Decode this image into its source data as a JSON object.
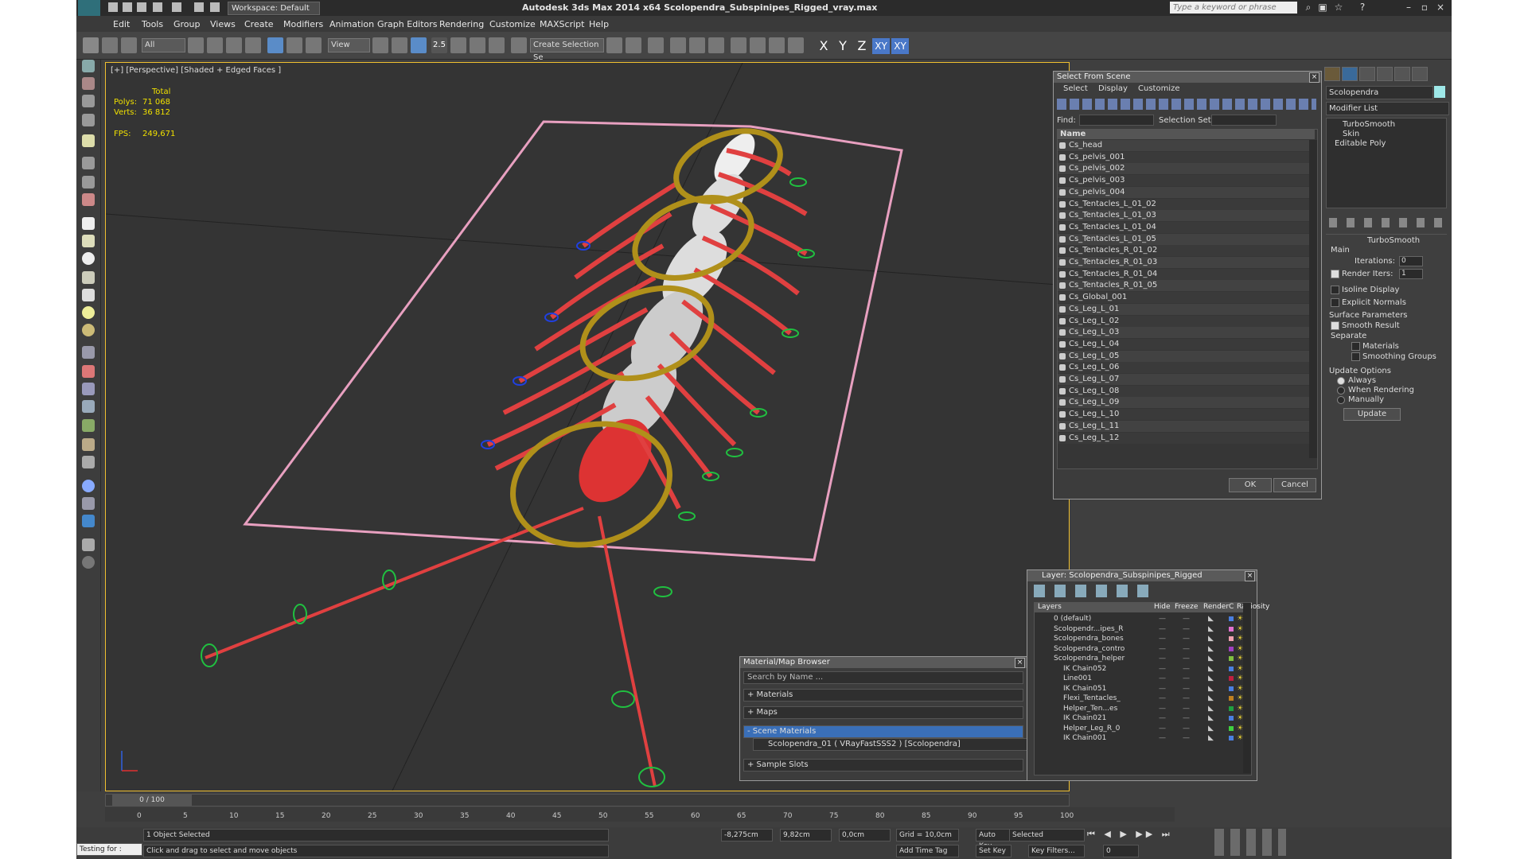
{
  "app": {
    "title": "Autodesk 3ds Max  2014 x64      Scolopendra_Subspinipes_Rigged_vray.max",
    "workspace": "Workspace: Default",
    "search_placeholder": "Type a keyword or phrase"
  },
  "menu": [
    "Edit",
    "Tools",
    "Group",
    "Views",
    "Create",
    "Modifiers",
    "Animation",
    "Graph Editors",
    "Rendering",
    "Customize",
    "MAXScript",
    "Help"
  ],
  "toolbar": {
    "filter": "All",
    "view": "View",
    "snap_angle": "2.5",
    "selection_set": "Create Selection Se",
    "axes": [
      "X",
      "Y",
      "Z",
      "XY",
      "XY"
    ]
  },
  "viewport": {
    "label": "[+] [Perspective] [Shaded + Edged Faces ]",
    "stats_total": "Total",
    "polys_label": "Polys:",
    "polys": "71 068",
    "verts_label": "Verts:",
    "verts": "36 812",
    "fps_label": "FPS:",
    "fps": "249,671"
  },
  "command_panel": {
    "object_name": "Scolopendra",
    "modifier_list": "Modifier List",
    "stack": [
      "TurboSmooth",
      "Skin",
      "Editable Poly"
    ],
    "rollout_title": "TurboSmooth",
    "main_label": "Main",
    "iterations_label": "Iterations:",
    "iterations": "0",
    "render_iters_label": "Render Iters:",
    "render_iters": "1",
    "isoline": "Isoline Display",
    "explicit_normals": "Explicit Normals",
    "surface_params": "Surface Parameters",
    "smooth_result": "Smooth Result",
    "separate": "Separate",
    "materials": "Materials",
    "smoothing_groups": "Smoothing Groups",
    "update_options": "Update Options",
    "always": "Always",
    "when_rendering": "When Rendering",
    "manually": "Manually",
    "update_btn": "Update"
  },
  "select_from_scene": {
    "title": "Select From Scene",
    "menu": [
      "Select",
      "Display",
      "Customize"
    ],
    "find_label": "Find:",
    "selset_label": "Selection Set:",
    "col_name": "Name",
    "items": [
      "Cs_head",
      "Cs_pelvis_001",
      "Cs_pelvis_002",
      "Cs_pelvis_003",
      "Cs_pelvis_004",
      "Cs_Tentacles_L_01_02",
      "Cs_Tentacles_L_01_03",
      "Cs_Tentacles_L_01_04",
      "Cs_Tentacles_L_01_05",
      "Cs_Tentacles_R_01_02",
      "Cs_Tentacles_R_01_03",
      "Cs_Tentacles_R_01_04",
      "Cs_Tentacles_R_01_05",
      "Cs_Global_001",
      "Cs_Leg_L_01",
      "Cs_Leg_L_02",
      "Cs_Leg_L_03",
      "Cs_Leg_L_04",
      "Cs_Leg_L_05",
      "Cs_Leg_L_06",
      "Cs_Leg_L_07",
      "Cs_Leg_L_08",
      "Cs_Leg_L_09",
      "Cs_Leg_L_10",
      "Cs_Leg_L_11",
      "Cs_Leg_L_12"
    ],
    "ok": "OK",
    "cancel": "Cancel"
  },
  "layer_dialog": {
    "title": "Layer: Scolopendra_Subspinipes_Rigged",
    "columns": [
      "Layers",
      "Hide",
      "Freeze",
      "Render",
      "C",
      "Radiosity"
    ],
    "rows": [
      {
        "name": "0 (default)",
        "color": "#4a7fe0"
      },
      {
        "name": "Scolopendr...ipes_R",
        "color": "#e070d0"
      },
      {
        "name": "Scolopendra_bones",
        "color": "#f0a0b0"
      },
      {
        "name": "Scolopendra_contro",
        "color": "#a040c0"
      },
      {
        "name": "Scolopendra_helper",
        "color": "#80c040"
      },
      {
        "name": "IK Chain052",
        "color": "#4a7fe0"
      },
      {
        "name": "Line001",
        "color": "#c02040"
      },
      {
        "name": "IK Chain051",
        "color": "#4a7fe0"
      },
      {
        "name": "Flexi_Tentacles_",
        "color": "#c08020"
      },
      {
        "name": "Helper_Ten...es",
        "color": "#20a040"
      },
      {
        "name": "IK Chain021",
        "color": "#4a7fe0"
      },
      {
        "name": "Helper_Leg_R_0",
        "color": "#40d040"
      },
      {
        "name": "IK Chain001",
        "color": "#4a7fe0"
      }
    ]
  },
  "material_browser": {
    "title": "Material/Map Browser",
    "search": "Search by Name ...",
    "materials": "+ Materials",
    "maps": "+ Maps",
    "scene_materials": "- Scene Materials",
    "material_item": "Scolopendra_01  ( VRayFastSSS2 ) [Scolopendra]",
    "sample_slots": "+ Sample Slots"
  },
  "timeline": {
    "frame": "0 / 100",
    "ticks": [
      "0",
      "5",
      "10",
      "15",
      "20",
      "25",
      "30",
      "35",
      "40",
      "45",
      "50",
      "55",
      "60",
      "65",
      "70",
      "75",
      "80",
      "85",
      "90",
      "95",
      "100"
    ]
  },
  "status": {
    "script": "Testing for :",
    "selected": "1 Object Selected",
    "prompt": "Click and drag to select and move objects",
    "x": "-8,275cm",
    "y": "9,82cm",
    "z": "0,0cm",
    "grid": "Grid = 10,0cm",
    "add_time_tag": "Add Time Tag",
    "auto_key": "Auto Key",
    "set_key": "Set Key",
    "key_mode": "Selected",
    "key_filters": "Key Filters...",
    "frame_num": "0"
  }
}
